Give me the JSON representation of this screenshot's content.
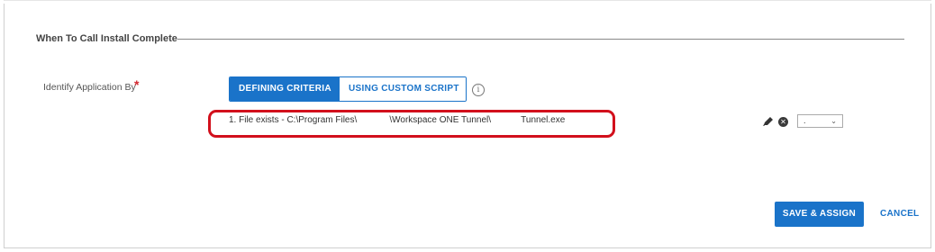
{
  "section": {
    "title": "When To Call Install Complete"
  },
  "identify": {
    "label": "Identify Application By",
    "required_mark": "*",
    "options": [
      {
        "label": "DEFINING CRITERIA",
        "selected": true
      },
      {
        "label": "USING CUSTOM SCRIPT",
        "selected": false
      }
    ],
    "info_glyph": "i"
  },
  "criteria": {
    "item_text": "1. File exists - C:\\Program Files\\             \\Workspace ONE Tunnel\\            Tunnel.exe",
    "dropdown_value": ".",
    "remove_glyph": "✕"
  },
  "footer": {
    "save_label": "SAVE & ASSIGN",
    "cancel_label": "CANCEL"
  },
  "colors": {
    "accent": "#1a73c9",
    "highlight": "#d2101c",
    "required": "#d2262e"
  },
  "icons": [
    "info-icon",
    "pencil-icon",
    "remove-icon",
    "chevron-down-icon"
  ]
}
